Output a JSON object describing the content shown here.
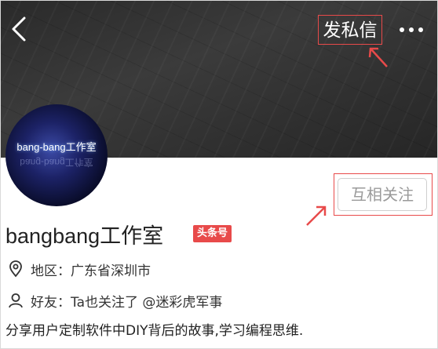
{
  "header": {
    "message_label": "发私信",
    "follow_label": "互相关注"
  },
  "avatar": {
    "text": "bang-bang工作室"
  },
  "profile": {
    "name": "bangbang工作室",
    "badge": "头条号",
    "region_label": "地区：",
    "region_value": "广东省深圳市",
    "friends_label": "好友：",
    "friends_value": "Ta也关注了 @迷彩虎军事",
    "bio": "分享用户定制软件中DIY背后的故事,学习编程思维."
  },
  "colors": {
    "accent_red": "#e84a4a",
    "banner": "#333333"
  },
  "icons": {
    "back": "chevron-left-icon",
    "more": "more-dots-icon",
    "location": "location-pin-icon",
    "friends": "user-icon"
  }
}
